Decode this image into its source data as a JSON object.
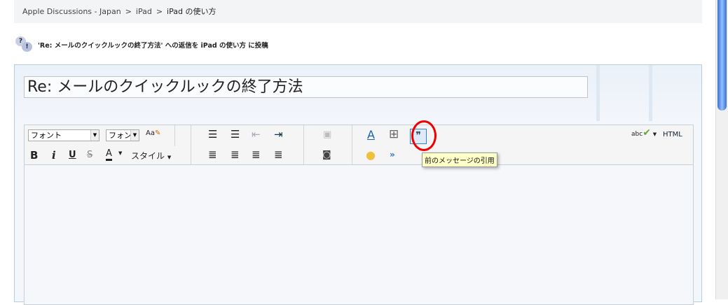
{
  "breadcrumb": [
    "Apple Discussions - Japan",
    ">",
    "iPad",
    ">",
    "iPad の使い方"
  ],
  "heading": "'Re: メールのクイックルックの終了方法' への返信を iPad の使い方 に投稿",
  "title_value": "Re: メールのクイックルックの終了方法",
  "toolbar": {
    "font": "フォント",
    "size": "フォン",
    "style": "スタイル",
    "html": "HTML",
    "bold": "B",
    "italic": "i",
    "underline": "U",
    "strike": "S",
    "color": "A",
    "spell": "abc"
  },
  "tooltip": "前のメッセージの引用"
}
